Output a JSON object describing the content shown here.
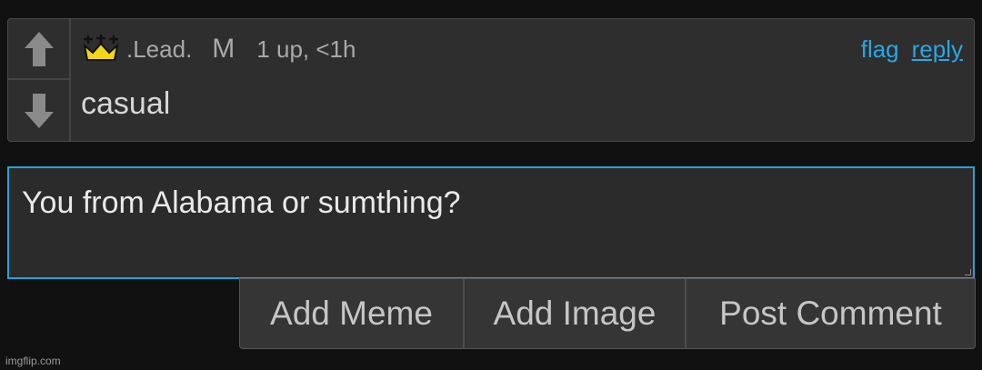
{
  "comment": {
    "username": ".Lead.",
    "badge": "M",
    "stats": "1 up, <1h",
    "flag_label": "flag",
    "reply_label": "reply",
    "text": "casual",
    "icons": {
      "upvote": "arrow-up-icon",
      "downvote": "arrow-down-icon",
      "rank": "crown-icon"
    },
    "colors": {
      "link": "#29a7e2",
      "crown": "#f3d417"
    }
  },
  "reply_box": {
    "value": "You from Alabama or sumthing?",
    "focus_color": "#1da4dc"
  },
  "buttons": {
    "add_meme": "Add Meme",
    "add_image": "Add Image",
    "post_comment": "Post Comment"
  },
  "watermark": "imgflip.com"
}
